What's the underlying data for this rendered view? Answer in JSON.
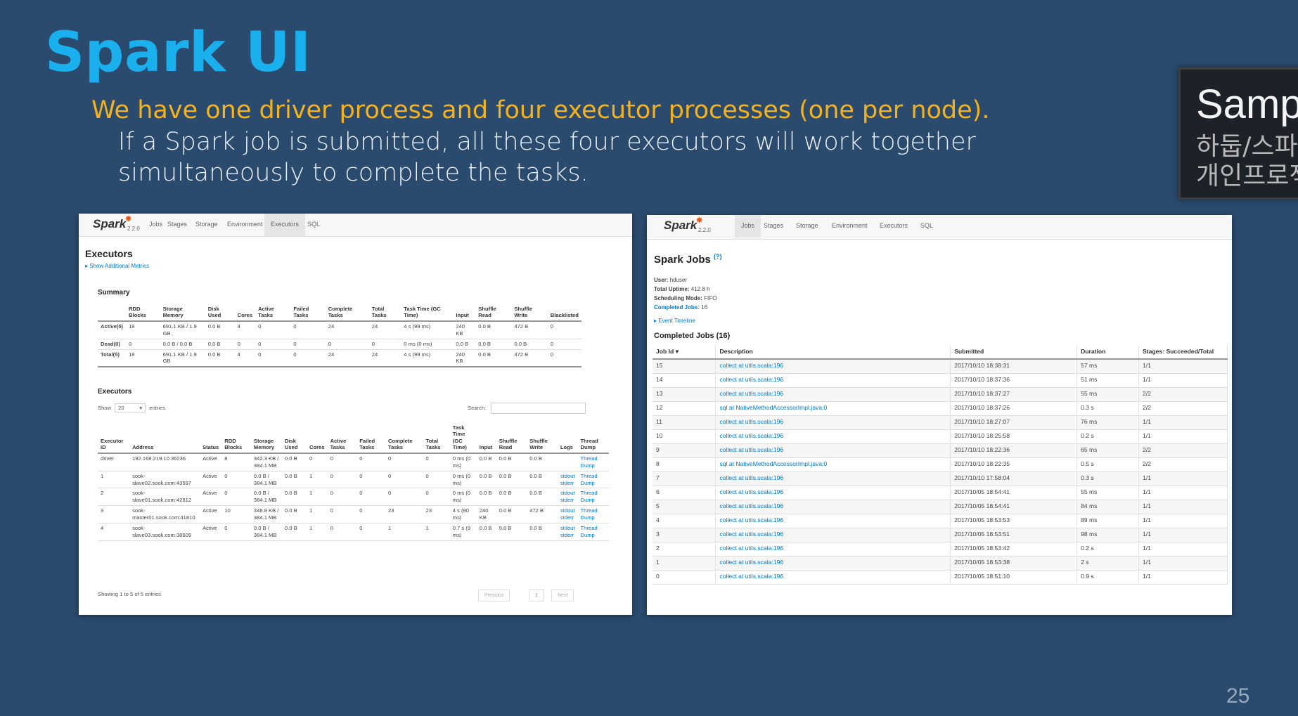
{
  "slide": {
    "title": "Spark UI",
    "subtitle": "We have one driver process and four executor processes (one per node).",
    "body": "If a Spark job is submitted, all these four executors will work together simultaneously to complete the tasks.",
    "page_number": "25"
  },
  "side_box": {
    "title": "Samp",
    "line1": "하둡/스파",
    "line2": "개인프로젝"
  },
  "colors": {
    "title": "#1ab0ee",
    "subtitle": "#f5b21a",
    "background": "#2a4a6e",
    "link": "#0077cc",
    "spark_star": "#e25a1c"
  },
  "exec_ui": {
    "logo": "Spark",
    "version": "2.2.0",
    "tabs": [
      "Jobs",
      "Stages",
      "Storage",
      "Environment",
      "Executors",
      "SQL"
    ],
    "active_tab": "Executors",
    "heading": "Executors",
    "show_metrics": "Show Additional Metrics",
    "summary_title": "Summary",
    "summary_headers": [
      "",
      "RDD Blocks",
      "Storage Memory",
      "Disk Used",
      "Cores",
      "Active Tasks",
      "Failed Tasks",
      "Complete Tasks",
      "Total Tasks",
      "Task Time (GC Time)",
      "Input",
      "Shuffle Read",
      "Shuffle Write",
      "Blacklisted"
    ],
    "summary_rows": [
      [
        "Active(5)",
        "18",
        "691.1 KB / 1.9 GB",
        "0.0 B",
        "4",
        "0",
        "0",
        "24",
        "24",
        "4 s (99 ms)",
        "240 KB",
        "0.0 B",
        "472 B",
        "0"
      ],
      [
        "Dead(0)",
        "0",
        "0.0 B / 0.0 B",
        "0.0 B",
        "0",
        "0",
        "0",
        "0",
        "0",
        "0 ms (0 ms)",
        "0.0 B",
        "0.0 B",
        "0.0 B",
        "0"
      ],
      [
        "Total(5)",
        "18",
        "691.1 KB / 1.9 GB",
        "0.0 B",
        "4",
        "0",
        "0",
        "24",
        "24",
        "4 s (99 ms)",
        "240 KB",
        "0.0 B",
        "472 B",
        "0"
      ]
    ],
    "executors_title": "Executors",
    "show_label": "Show",
    "show_value": "20",
    "entries_label": "entries",
    "search_label": "Search:",
    "exec_headers": [
      "Executor ID",
      "Address",
      "Status",
      "RDD Blocks",
      "Storage Memory",
      "Disk Used",
      "Cores",
      "Active Tasks",
      "Failed Tasks",
      "Complete Tasks",
      "Total Tasks",
      "Task Time (GC Time)",
      "Input",
      "Shuffle Read",
      "Shuffle Write",
      "Logs",
      "Thread Dump"
    ],
    "exec_rows": [
      [
        "driver",
        "192.168.219.10:36236",
        "Active",
        "8",
        "342.3 KB / 384.1 MB",
        "0.0 B",
        "0",
        "0",
        "0",
        "0",
        "0",
        "0 ms (0 ms)",
        "0.0 B",
        "0.0 B",
        "0.0 B",
        "",
        "Thread Dump"
      ],
      [
        "1",
        "sook-slave02.sook.com:43597",
        "Active",
        "0",
        "0.0 B / 384.1 MB",
        "0.0 B",
        "1",
        "0",
        "0",
        "0",
        "0",
        "0 ms (0 ms)",
        "0.0 B",
        "0.0 B",
        "0.0 B",
        "stdout stderr",
        "Thread Dump"
      ],
      [
        "2",
        "sook-slave01.sook.com:42812",
        "Active",
        "0",
        "0.0 B / 384.1 MB",
        "0.0 B",
        "1",
        "0",
        "0",
        "0",
        "0",
        "0 ms (0 ms)",
        "0.0 B",
        "0.0 B",
        "0.0 B",
        "stdout stderr",
        "Thread Dump"
      ],
      [
        "3",
        "sook-master01.sook.com:41810",
        "Active",
        "10",
        "348.8 KB / 384.1 MB",
        "0.0 B",
        "1",
        "0",
        "0",
        "23",
        "23",
        "4 s (90 ms)",
        "240 KB",
        "0.0 B",
        "472 B",
        "stdout stderr",
        "Thread Dump"
      ],
      [
        "4",
        "sook-slave03.sook.com:38609",
        "Active",
        "0",
        "0.0 B / 384.1 MB",
        "0.0 B",
        "1",
        "0",
        "0",
        "1",
        "1",
        "0.7 s (9 ms)",
        "0.0 B",
        "0.0 B",
        "0.0 B",
        "stdout stderr",
        "Thread Dump"
      ]
    ],
    "showing": "Showing 1 to 5 of 5 entries",
    "pagination": {
      "prev": "Previous",
      "page": "1",
      "next": "Next"
    }
  },
  "jobs_ui": {
    "logo": "Spark",
    "version": "2.2.0",
    "tabs": [
      "Jobs",
      "Stages",
      "Storage",
      "Environment",
      "Executors",
      "SQL"
    ],
    "active_tab": "Jobs",
    "heading": "Spark Jobs",
    "help": "(?)",
    "user_label": "User:",
    "user_value": "hduser",
    "uptime_label": "Total Uptime:",
    "uptime_value": "412.8 h",
    "mode_label": "Scheduling Mode:",
    "mode_value": "FIFO",
    "completed_label": "Completed Jobs:",
    "completed_value": "16",
    "event_timeline": "Event Timeline",
    "completed_title": "Completed Jobs (16)",
    "headers": [
      "Job Id ▾",
      "Description",
      "Submitted",
      "Duration",
      "Stages: Succeeded/Total"
    ],
    "rows": [
      [
        "15",
        "collect at utils.scala:196",
        "2017/10/10 18:38:31",
        "57 ms",
        "1/1"
      ],
      [
        "14",
        "collect at utils.scala:196",
        "2017/10/10 18:37:36",
        "51 ms",
        "1/1"
      ],
      [
        "13",
        "collect at utils.scala:196",
        "2017/10/10 18:37:27",
        "55 ms",
        "2/2"
      ],
      [
        "12",
        "sql at NativeMethodAccessorImpl.java:0",
        "2017/10/10 18:37:26",
        "0.3 s",
        "2/2"
      ],
      [
        "11",
        "collect at utils.scala:196",
        "2017/10/10 18:27:07",
        "76 ms",
        "1/1"
      ],
      [
        "10",
        "collect at utils.scala:196",
        "2017/10/10 18:25:58",
        "0.2 s",
        "1/1"
      ],
      [
        "9",
        "collect at utils.scala:196",
        "2017/10/10 18:22:36",
        "65 ms",
        "2/2"
      ],
      [
        "8",
        "sql at NativeMethodAccessorImpl.java:0",
        "2017/10/10 18:22:35",
        "0.5 s",
        "2/2"
      ],
      [
        "7",
        "collect at utils.scala:196",
        "2017/10/10 17:58:04",
        "0.3 s",
        "1/1"
      ],
      [
        "6",
        "collect at utils.scala:196",
        "2017/10/05 18:54:41",
        "55 ms",
        "1/1"
      ],
      [
        "5",
        "collect at utils.scala:196",
        "2017/10/05 18:54:41",
        "84 ms",
        "1/1"
      ],
      [
        "4",
        "collect at utils.scala:196",
        "2017/10/05 18:53:53",
        "89 ms",
        "1/1"
      ],
      [
        "3",
        "collect at utils.scala:196",
        "2017/10/05 18:53:51",
        "98 ms",
        "1/1"
      ],
      [
        "2",
        "collect at utils.scala:196",
        "2017/10/05 18:53:42",
        "0.2 s",
        "1/1"
      ],
      [
        "1",
        "collect at utils.scala:196",
        "2017/10/05 18:53:38",
        "2 s",
        "1/1"
      ],
      [
        "0",
        "collect at utils.scala:196",
        "2017/10/05 18:51:10",
        "0.9 s",
        "1/1"
      ]
    ]
  }
}
